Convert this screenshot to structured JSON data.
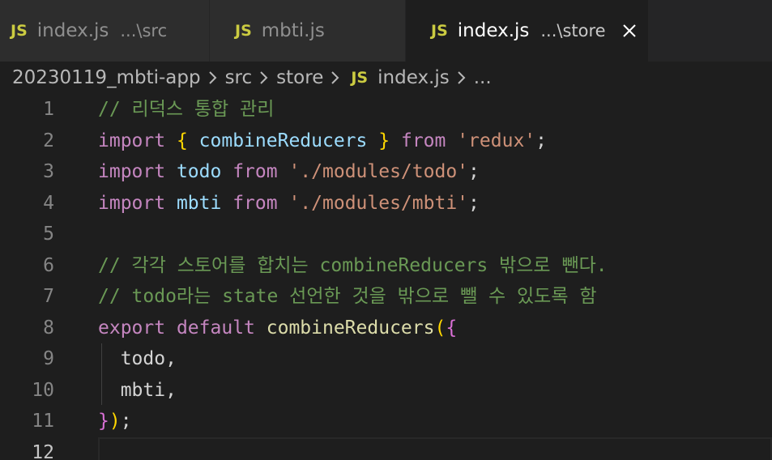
{
  "tabs": [
    {
      "icon": "JS",
      "name": "index.js",
      "description": "...\\src",
      "active": false
    },
    {
      "icon": "JS",
      "name": "mbti.js",
      "description": "",
      "active": false
    },
    {
      "icon": "JS",
      "name": "index.js",
      "description": "...\\store",
      "active": true
    }
  ],
  "breadcrumb": {
    "items": [
      "20230119_mbti-app",
      "src",
      "store"
    ],
    "file_icon": "JS",
    "file": "index.js",
    "ellipsis": "..."
  },
  "colors": {
    "comment": "#6a9955",
    "keyword": "#c586c0",
    "brace": "#ffd700",
    "brace_nested": "#da70d6",
    "variable": "#9cdcfe",
    "function": "#dcdcaa",
    "string": "#ce9178",
    "js_icon": "#cbcb41"
  },
  "editor": {
    "current_line": 12,
    "lines": [
      {
        "number": "1",
        "tokens": [
          {
            "t": "// 리덕스 통합 관리",
            "c": "comment"
          }
        ]
      },
      {
        "number": "2",
        "tokens": [
          {
            "t": "import",
            "c": "keyword"
          },
          {
            "t": " ",
            "c": "punct"
          },
          {
            "t": "{",
            "c": "brace"
          },
          {
            "t": " ",
            "c": "punct"
          },
          {
            "t": "combineReducers",
            "c": "var"
          },
          {
            "t": " ",
            "c": "punct"
          },
          {
            "t": "}",
            "c": "brace"
          },
          {
            "t": " ",
            "c": "punct"
          },
          {
            "t": "from",
            "c": "keyword"
          },
          {
            "t": " ",
            "c": "punct"
          },
          {
            "t": "'redux'",
            "c": "string"
          },
          {
            "t": ";",
            "c": "punct"
          }
        ]
      },
      {
        "number": "3",
        "tokens": [
          {
            "t": "import",
            "c": "keyword"
          },
          {
            "t": " ",
            "c": "punct"
          },
          {
            "t": "todo",
            "c": "var"
          },
          {
            "t": " ",
            "c": "punct"
          },
          {
            "t": "from",
            "c": "keyword"
          },
          {
            "t": " ",
            "c": "punct"
          },
          {
            "t": "'./modules/todo'",
            "c": "string"
          },
          {
            "t": ";",
            "c": "punct"
          }
        ]
      },
      {
        "number": "4",
        "tokens": [
          {
            "t": "import",
            "c": "keyword"
          },
          {
            "t": " ",
            "c": "punct"
          },
          {
            "t": "mbti",
            "c": "var"
          },
          {
            "t": " ",
            "c": "punct"
          },
          {
            "t": "from",
            "c": "keyword"
          },
          {
            "t": " ",
            "c": "punct"
          },
          {
            "t": "'./modules/mbti'",
            "c": "string"
          },
          {
            "t": ";",
            "c": "punct"
          }
        ]
      },
      {
        "number": "5",
        "tokens": []
      },
      {
        "number": "6",
        "tokens": [
          {
            "t": "// 각각 스토어를 합치는 combineReducers 밖으로 뺀다.",
            "c": "comment"
          }
        ]
      },
      {
        "number": "7",
        "tokens": [
          {
            "t": "// todo라는 state 선언한 것을 밖으로 뺄 수 있도록 함",
            "c": "comment"
          }
        ]
      },
      {
        "number": "8",
        "tokens": [
          {
            "t": "export",
            "c": "keyword"
          },
          {
            "t": " ",
            "c": "punct"
          },
          {
            "t": "default",
            "c": "keyword"
          },
          {
            "t": " ",
            "c": "punct"
          },
          {
            "t": "combineReducers",
            "c": "func"
          },
          {
            "t": "(",
            "c": "brace"
          },
          {
            "t": "{",
            "c": "brace2"
          }
        ]
      },
      {
        "number": "9",
        "tokens": [
          {
            "t": "  todo,",
            "c": "punct"
          }
        ]
      },
      {
        "number": "10",
        "tokens": [
          {
            "t": "  mbti,",
            "c": "punct"
          }
        ]
      },
      {
        "number": "11",
        "tokens": [
          {
            "t": "}",
            "c": "brace2"
          },
          {
            "t": ")",
            "c": "brace"
          },
          {
            "t": ";",
            "c": "punct"
          }
        ]
      },
      {
        "number": "12",
        "tokens": []
      }
    ]
  }
}
